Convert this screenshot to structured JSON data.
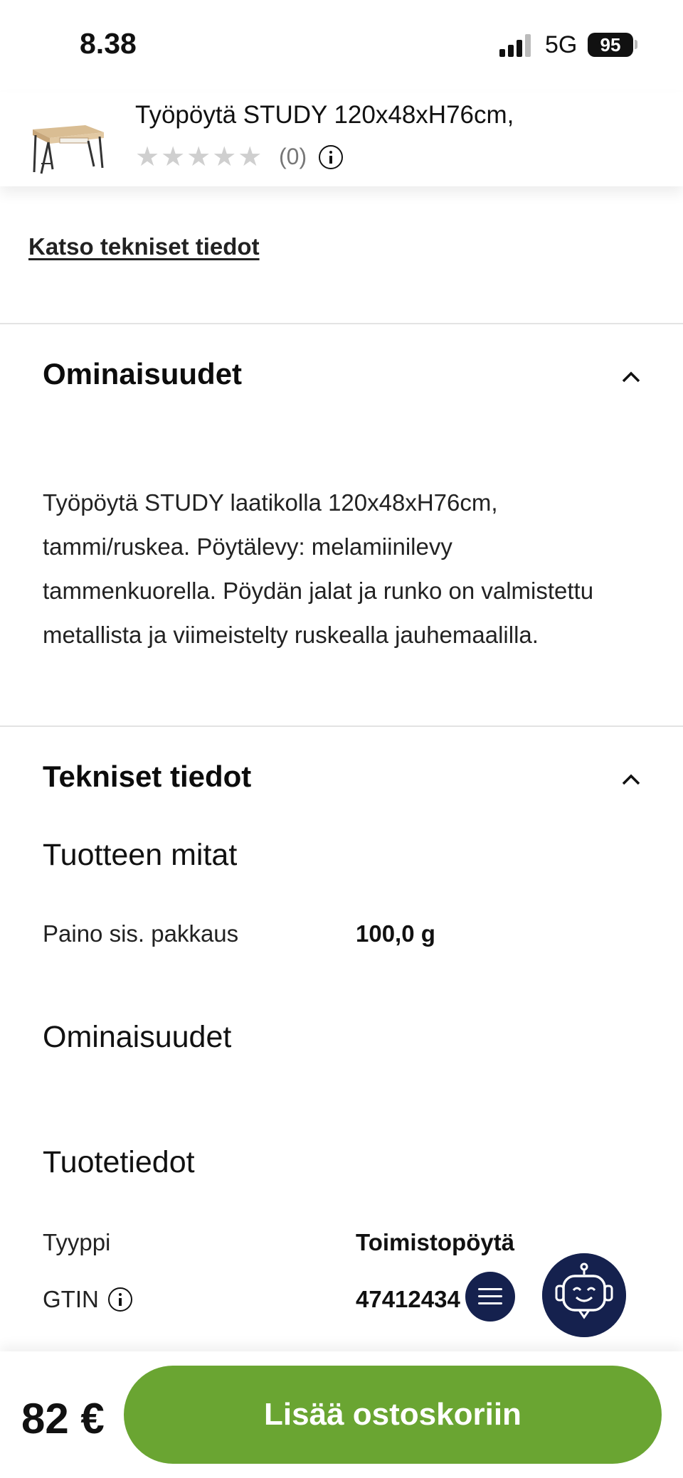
{
  "status_bar": {
    "time": "8.38",
    "network": "5G",
    "battery": "95"
  },
  "product_header": {
    "title": "Työpöytä STUDY 120x48xH76cm,",
    "stars": "★★★★★",
    "rating_count": "(0)"
  },
  "links": {
    "technical_details": "Katso tekniset tiedot"
  },
  "features_section": {
    "title": "Ominaisuudet",
    "description": "Työpöytä STUDY laatikolla 120x48xH76cm, tammi/ruskea. Pöytälevy: melamiinilevy tammenkuorella. Pöydän jalat ja runko on valmistettu metallista ja viimeistelty ruskealla jauhemaalilla."
  },
  "technical_section": {
    "title": "Tekniset tiedot",
    "dimensions_title": "Tuotteen mitat",
    "weight_label": "Paino sis. pakkaus",
    "weight_value": "100,0 g",
    "properties_title": "Ominaisuudet",
    "product_info_title": "Tuotetiedot",
    "type_label": "Tyyppi",
    "type_value": "Toimistopöytä",
    "gtin_label": "GTIN",
    "gtin_value": "47412434   36"
  },
  "bottom_bar": {
    "price": "82 €",
    "add_to_cart": "Lisää ostoskoriin"
  },
  "colors": {
    "accent_green": "#6aa532",
    "fab_navy": "#15214e"
  }
}
